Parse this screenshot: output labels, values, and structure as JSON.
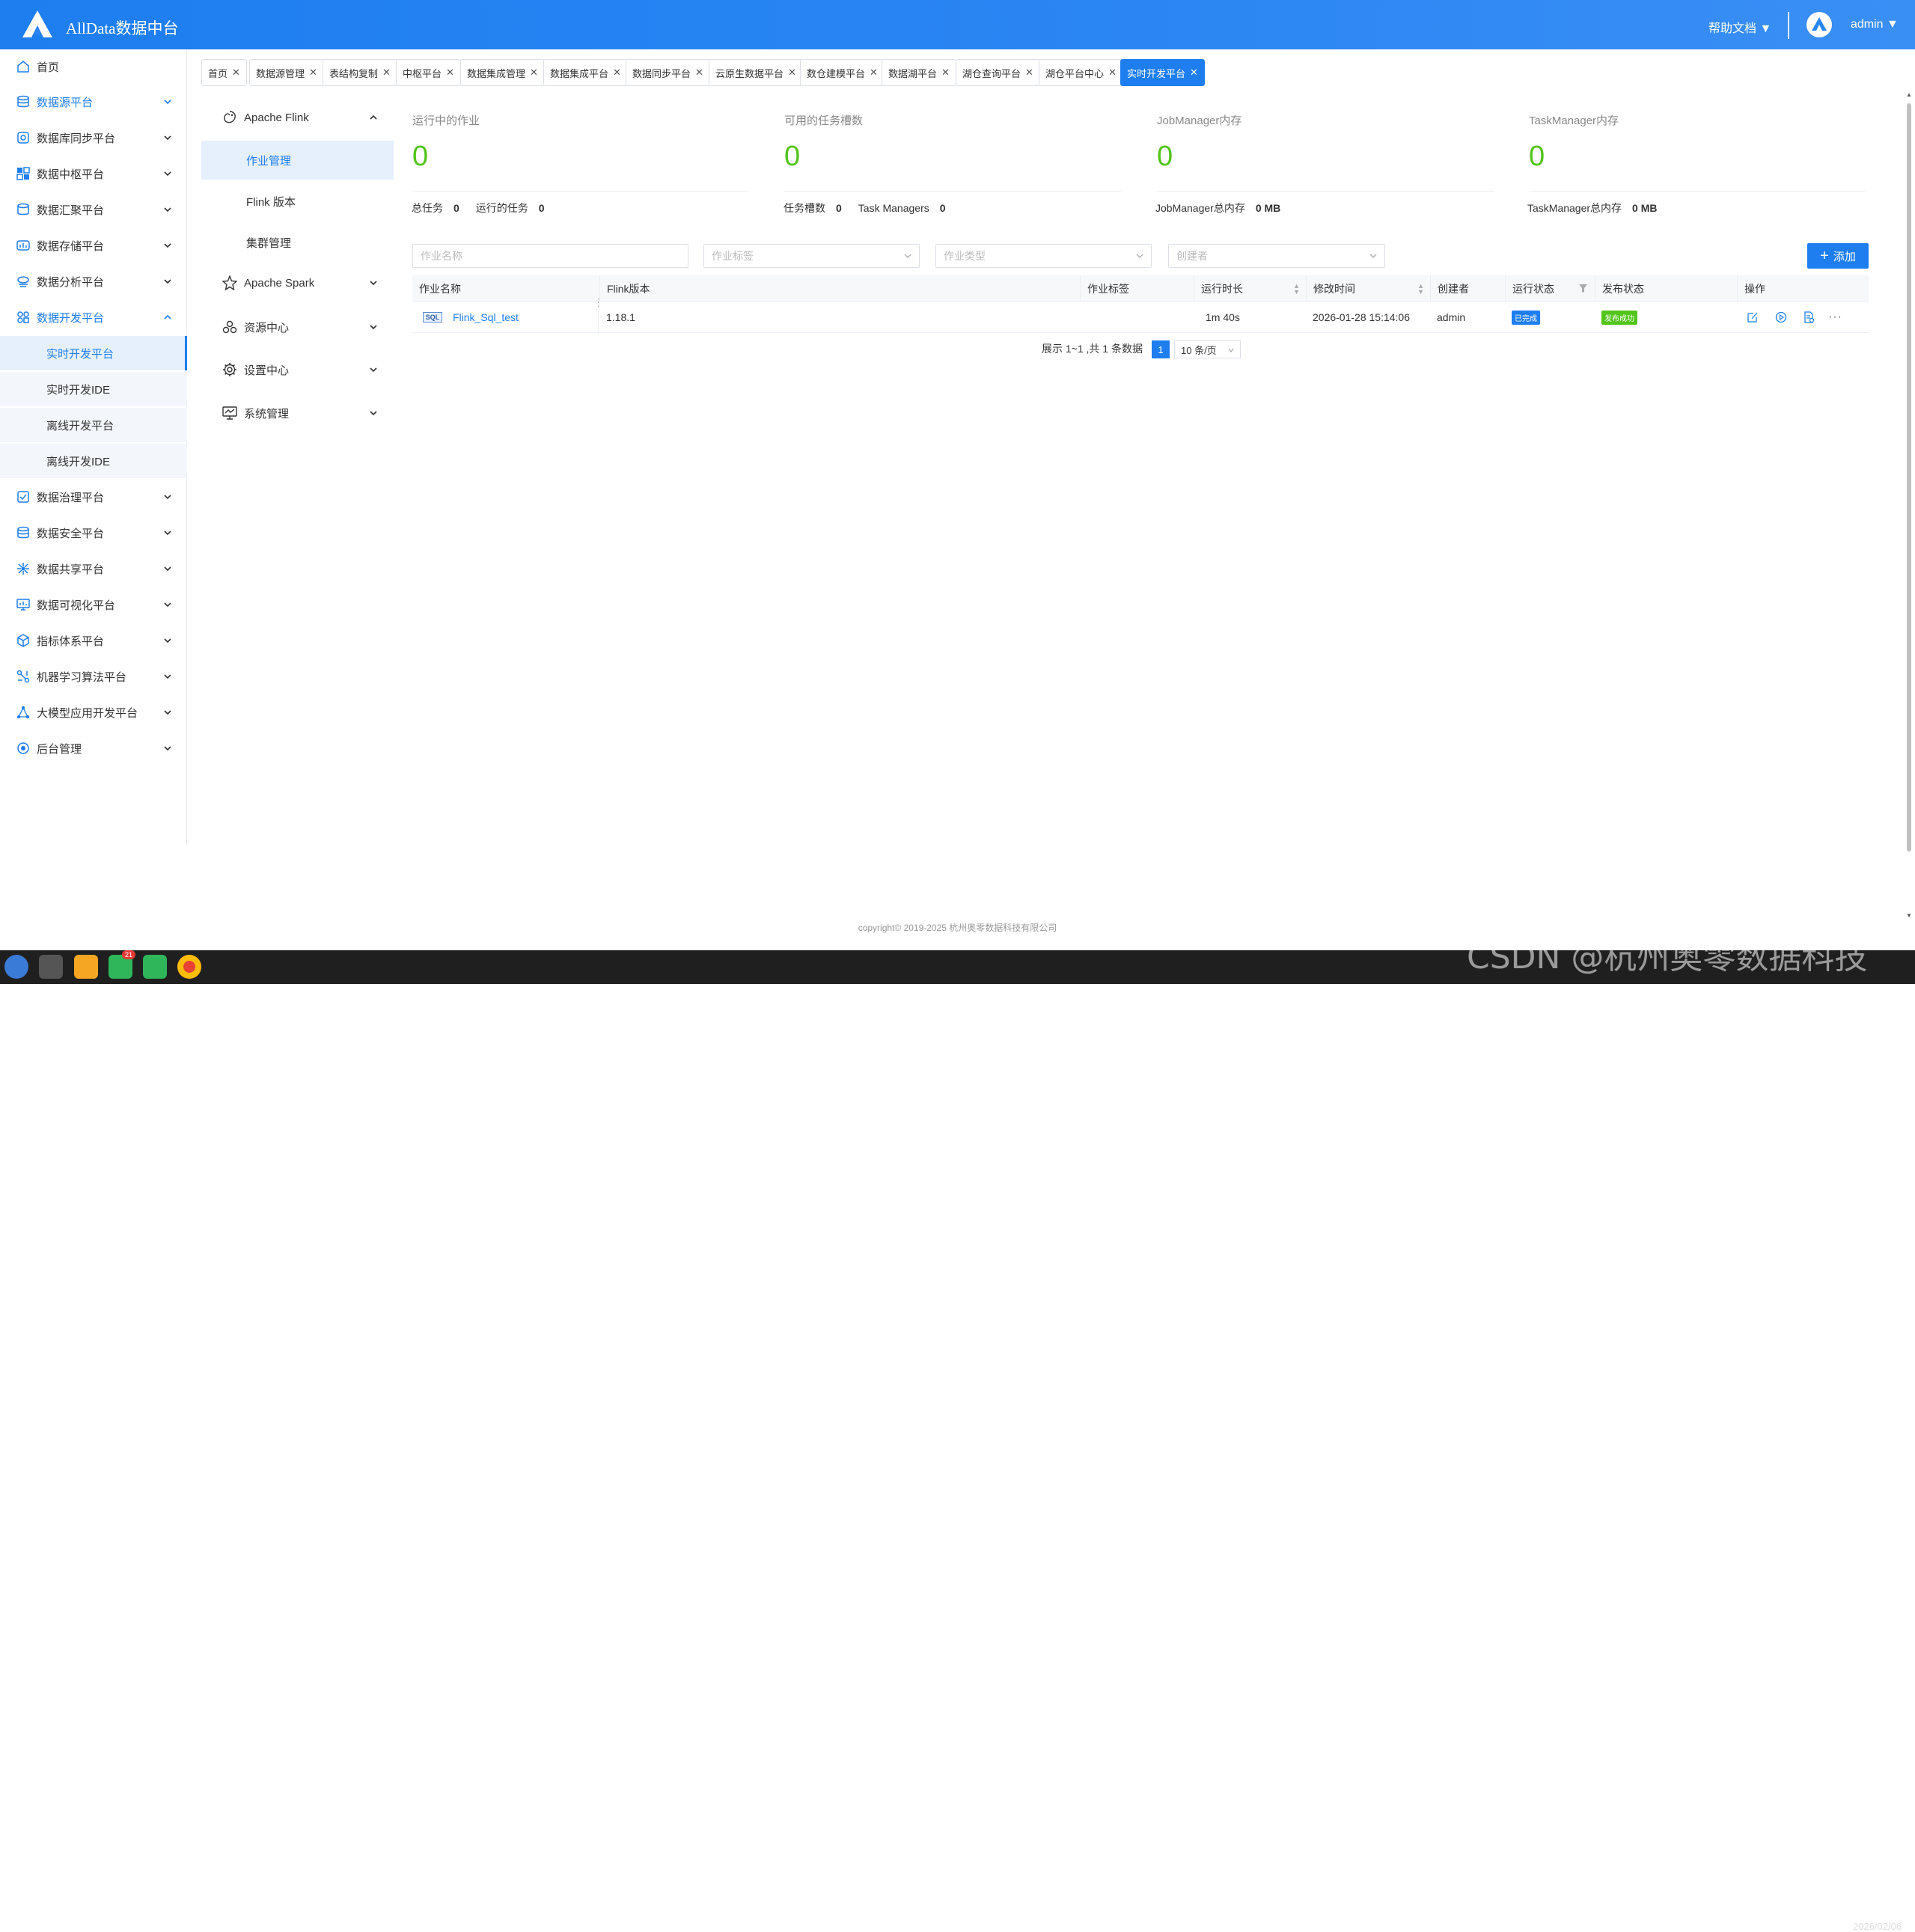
{
  "header": {
    "brand": "AllData数据中台",
    "help": "帮助文档 ▼",
    "user": "admin ▼"
  },
  "sidebar": {
    "items": [
      {
        "label": "首页",
        "icon": "home-icon"
      },
      {
        "label": "数据源平台",
        "icon": "database-icon"
      },
      {
        "label": "数据库同步平台",
        "icon": "sync-icon"
      },
      {
        "label": "数据中枢平台",
        "icon": "grid-icon"
      },
      {
        "label": "数据汇聚平台",
        "icon": "layers-icon"
      },
      {
        "label": "数据存储平台",
        "icon": "storage-icon"
      },
      {
        "label": "数据分析平台",
        "icon": "analysis-icon"
      },
      {
        "label": "数据开发平台",
        "icon": "dev-icon"
      },
      {
        "label": "数据治理平台",
        "icon": "governance-icon"
      },
      {
        "label": "数据安全平台",
        "icon": "security-icon"
      },
      {
        "label": "数据共享平台",
        "icon": "share-icon"
      },
      {
        "label": "数据可视化平台",
        "icon": "monitor-icon"
      },
      {
        "label": "指标体系平台",
        "icon": "cube-icon"
      },
      {
        "label": "机器学习算法平台",
        "icon": "ml-icon"
      },
      {
        "label": "大模型应用开发平台",
        "icon": "network-icon"
      },
      {
        "label": "后台管理",
        "icon": "admin-icon"
      }
    ],
    "sub_items": [
      {
        "label": "实时开发平台"
      },
      {
        "label": "实时开发IDE"
      },
      {
        "label": "离线开发平台"
      },
      {
        "label": "离线开发IDE"
      }
    ]
  },
  "tags": [
    {
      "label": "首页"
    },
    {
      "label": "数据源管理"
    },
    {
      "label": "表结构复制"
    },
    {
      "label": "中枢平台"
    },
    {
      "label": "数据集成管理"
    },
    {
      "label": "数据集成平台"
    },
    {
      "label": "数据同步平台"
    },
    {
      "label": "云原生数据平台"
    },
    {
      "label": "数仓建模平台"
    },
    {
      "label": "数据湖平台"
    },
    {
      "label": "湖仓查询平台"
    },
    {
      "label": "湖仓平台中心"
    },
    {
      "label": "实时开发平台"
    }
  ],
  "menu2": {
    "flink": "Apache Flink",
    "flink_subs": [
      "作业管理",
      "Flink 版本",
      "集群管理"
    ],
    "spark": "Apache Spark",
    "resource": "资源中心",
    "settings": "设置中心",
    "system": "系统管理"
  },
  "stats": [
    {
      "title": "运行中的作业",
      "value": "0"
    },
    {
      "title": "可用的任务槽数",
      "value": "0"
    },
    {
      "title": "JobManager内存",
      "value": "0"
    },
    {
      "title": "TaskManager内存",
      "value": "0"
    }
  ],
  "stat_subs": {
    "total_tasks_label": "总任务",
    "total_tasks": "0",
    "running_tasks_label": "运行的任务",
    "running_tasks": "0",
    "slots_label": "任务槽数",
    "slots": "0",
    "tm_label": "Task Managers",
    "tm": "0",
    "jm_mem_label": "JobManager总内存",
    "jm_mem": "0 MB",
    "tm_mem_label": "TaskManager总内存",
    "tm_mem": "0 MB"
  },
  "filters": {
    "job_name": "作业名称",
    "job_tag": "作业标签",
    "job_type": "作业类型",
    "creator": "创建者",
    "add_button": "添加"
  },
  "table": {
    "headers": [
      "作业名称",
      "Flink版本",
      "作业标签",
      "运行时长",
      "修改时间",
      "创建者",
      "运行状态",
      "发布状态",
      "操作"
    ],
    "rows": [
      {
        "type_badge": "SQL",
        "name": "Flink_Sql_test",
        "version": "1.18.1",
        "tag": "",
        "duration": "1m 40s",
        "modified": "2026-01-28 15:14:06",
        "creator": "admin",
        "run_status": "已完成",
        "publish_status": "发布成功"
      }
    ]
  },
  "pager": {
    "summary": "展示 1~1 ,共 1 条数据",
    "page": "1",
    "page_size": "10 条/页"
  },
  "footer": {
    "copyright": "copyright© 2019-2025 杭州奥零数据科技有限公司"
  },
  "taskbar": {
    "badge_count": "21",
    "date": "2026/02/06"
  },
  "watermark": "CSDN @杭州奥零数据科技",
  "colors": {
    "primary": "#1e7ef0",
    "success": "#52c41a",
    "header": "#2b86f3"
  }
}
